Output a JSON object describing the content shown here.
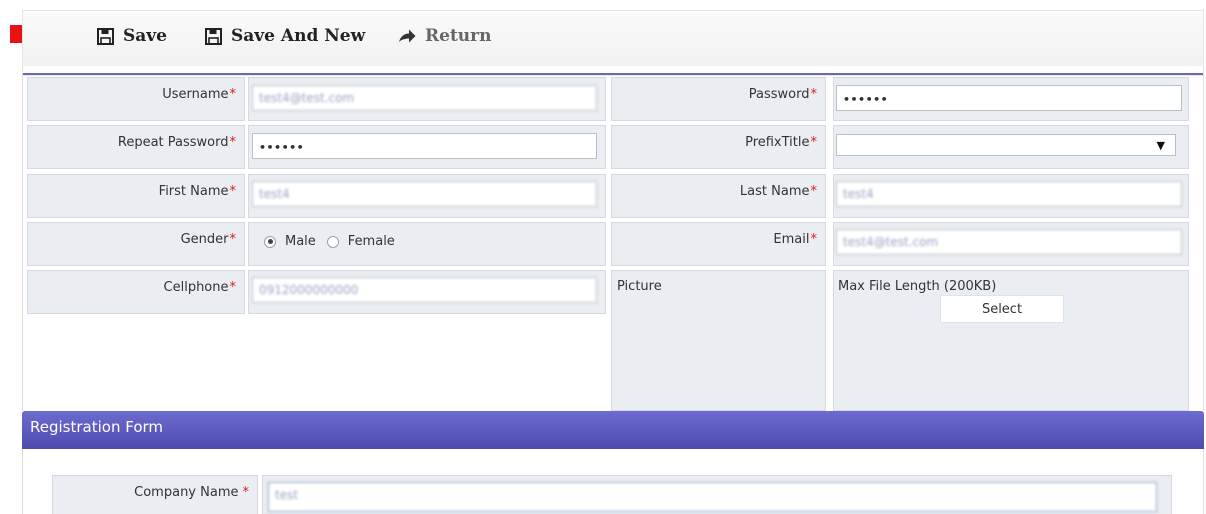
{
  "toolbar": {
    "save_label": "Save",
    "save_new_label": "Save And New",
    "return_label": "Return"
  },
  "form": {
    "username": {
      "label": "Username",
      "required": "*",
      "value": "test4@test.com"
    },
    "password": {
      "label": "Password",
      "required": "*",
      "value": "••••••"
    },
    "repeat_password": {
      "label": "Repeat Password",
      "required": "*",
      "value": "••••••"
    },
    "prefix_title": {
      "label": "PrefixTitle",
      "required": "*",
      "value": "",
      "arrow": "▼"
    },
    "first_name": {
      "label": "First Name",
      "required": "*",
      "value": "test4"
    },
    "last_name": {
      "label": "Last Name",
      "required": "*",
      "value": "test4"
    },
    "gender": {
      "label": "Gender",
      "required": "*",
      "options": [
        "Male",
        "Female"
      ],
      "selected": "Male"
    },
    "email": {
      "label": "Email",
      "required": "*",
      "value": "test4@test.com"
    },
    "cellphone": {
      "label": "Cellphone",
      "required": "*",
      "value": "0912000000000"
    },
    "picture": {
      "label": "Picture",
      "max_length": "Max File Length (200KB)",
      "select_label": "Select"
    }
  },
  "registration": {
    "header": "Registration Form",
    "company_name": {
      "label": "Company Name",
      "required": "*",
      "value": "test"
    }
  },
  "colors": {
    "accent": "#5753b9",
    "cell_bg": "#eaedf1",
    "required": "#d42020",
    "arrow": "#e81212"
  },
  "icons": {
    "save": "floppy-disk-icon",
    "save_new": "floppy-disk-icon",
    "return": "arrow-right-icon",
    "indicator": "red-arrow-icon"
  }
}
